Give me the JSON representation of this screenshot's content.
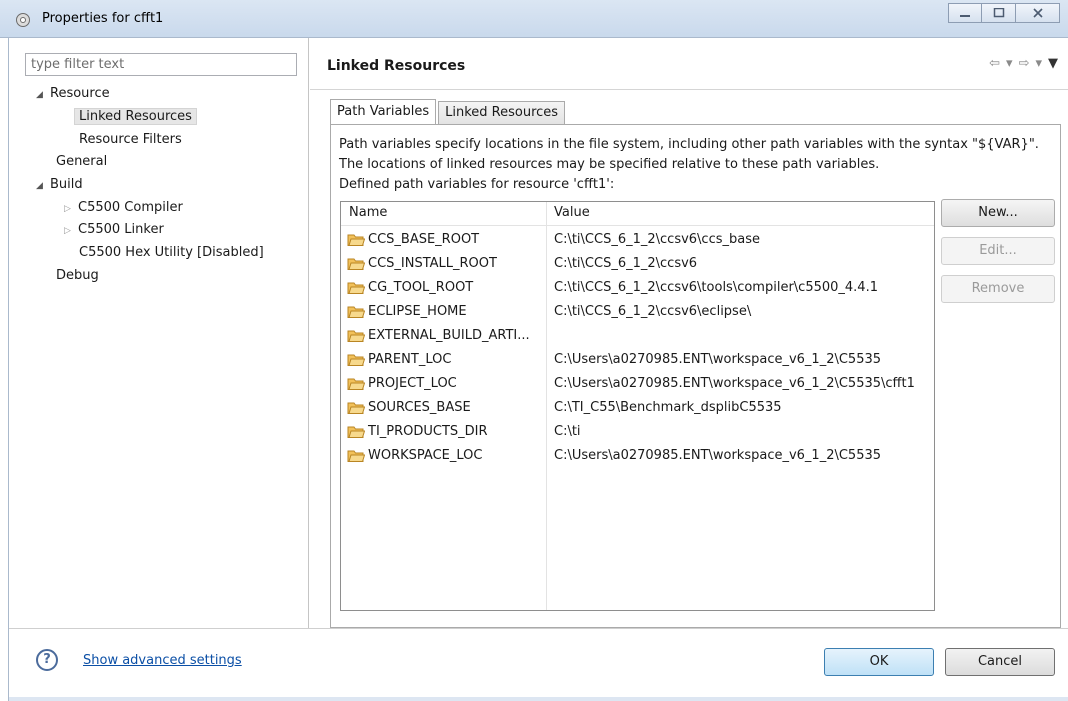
{
  "window": {
    "title": "Properties for cfft1",
    "minimize_icon": "minimize-icon",
    "maximize_icon": "maximize-icon",
    "close_icon": "close-icon"
  },
  "filter": {
    "placeholder": "type filter text"
  },
  "tree": [
    {
      "label": "Resource",
      "twisty": "expanded"
    },
    {
      "label": "Linked Resources",
      "selected": true
    },
    {
      "label": "Resource Filters"
    },
    {
      "label": "General"
    },
    {
      "label": "Build",
      "twisty": "expanded"
    },
    {
      "label": "C5500 Compiler",
      "twisty": "collapsed"
    },
    {
      "label": "C5500 Linker",
      "twisty": "collapsed"
    },
    {
      "label": "C5500 Hex Utility  [Disabled]"
    },
    {
      "label": "Debug"
    }
  ],
  "page": {
    "title": "Linked Resources",
    "tabs": [
      {
        "label": "Path Variables",
        "active": true
      },
      {
        "label": "Linked Resources",
        "active": false
      }
    ],
    "description_line1": "Path variables specify locations in the file system, including other path variables with the syntax \"${VAR}\".",
    "description_line2": "The locations of linked resources may be specified relative to these path variables.",
    "defined_label": "Defined path variables for resource 'cfft1':",
    "columns": {
      "name": "Name",
      "value": "Value"
    },
    "rows": [
      {
        "name": "CCS_BASE_ROOT",
        "value": "C:\\ti\\CCS_6_1_2\\ccsv6\\ccs_base"
      },
      {
        "name": "CCS_INSTALL_ROOT",
        "value": "C:\\ti\\CCS_6_1_2\\ccsv6"
      },
      {
        "name": "CG_TOOL_ROOT",
        "value": "C:\\ti\\CCS_6_1_2\\ccsv6\\tools\\compiler\\c5500_4.4.1"
      },
      {
        "name": "ECLIPSE_HOME",
        "value": "C:\\ti\\CCS_6_1_2\\ccsv6\\eclipse\\"
      },
      {
        "name": "EXTERNAL_BUILD_ARTI...",
        "value": ""
      },
      {
        "name": "PARENT_LOC",
        "value": "C:\\Users\\a0270985.ENT\\workspace_v6_1_2\\C5535"
      },
      {
        "name": "PROJECT_LOC",
        "value": "C:\\Users\\a0270985.ENT\\workspace_v6_1_2\\C5535\\cfft1"
      },
      {
        "name": "SOURCES_BASE",
        "value": "C:\\TI_C55\\Benchmark_dsplibC5535"
      },
      {
        "name": "TI_PRODUCTS_DIR",
        "value": "C:\\ti"
      },
      {
        "name": "WORKSPACE_LOC",
        "value": "C:\\Users\\a0270985.ENT\\workspace_v6_1_2\\C5535"
      }
    ],
    "buttons": {
      "new": "New...",
      "edit": "Edit...",
      "remove": "Remove"
    }
  },
  "footer": {
    "help_icon_glyph": "?",
    "advanced_link": "Show advanced settings",
    "ok": "OK",
    "cancel": "Cancel"
  },
  "colors": {
    "link": "#0b4fa6",
    "ok_border": "#3c7fb1",
    "folder": "#e2a93b"
  }
}
